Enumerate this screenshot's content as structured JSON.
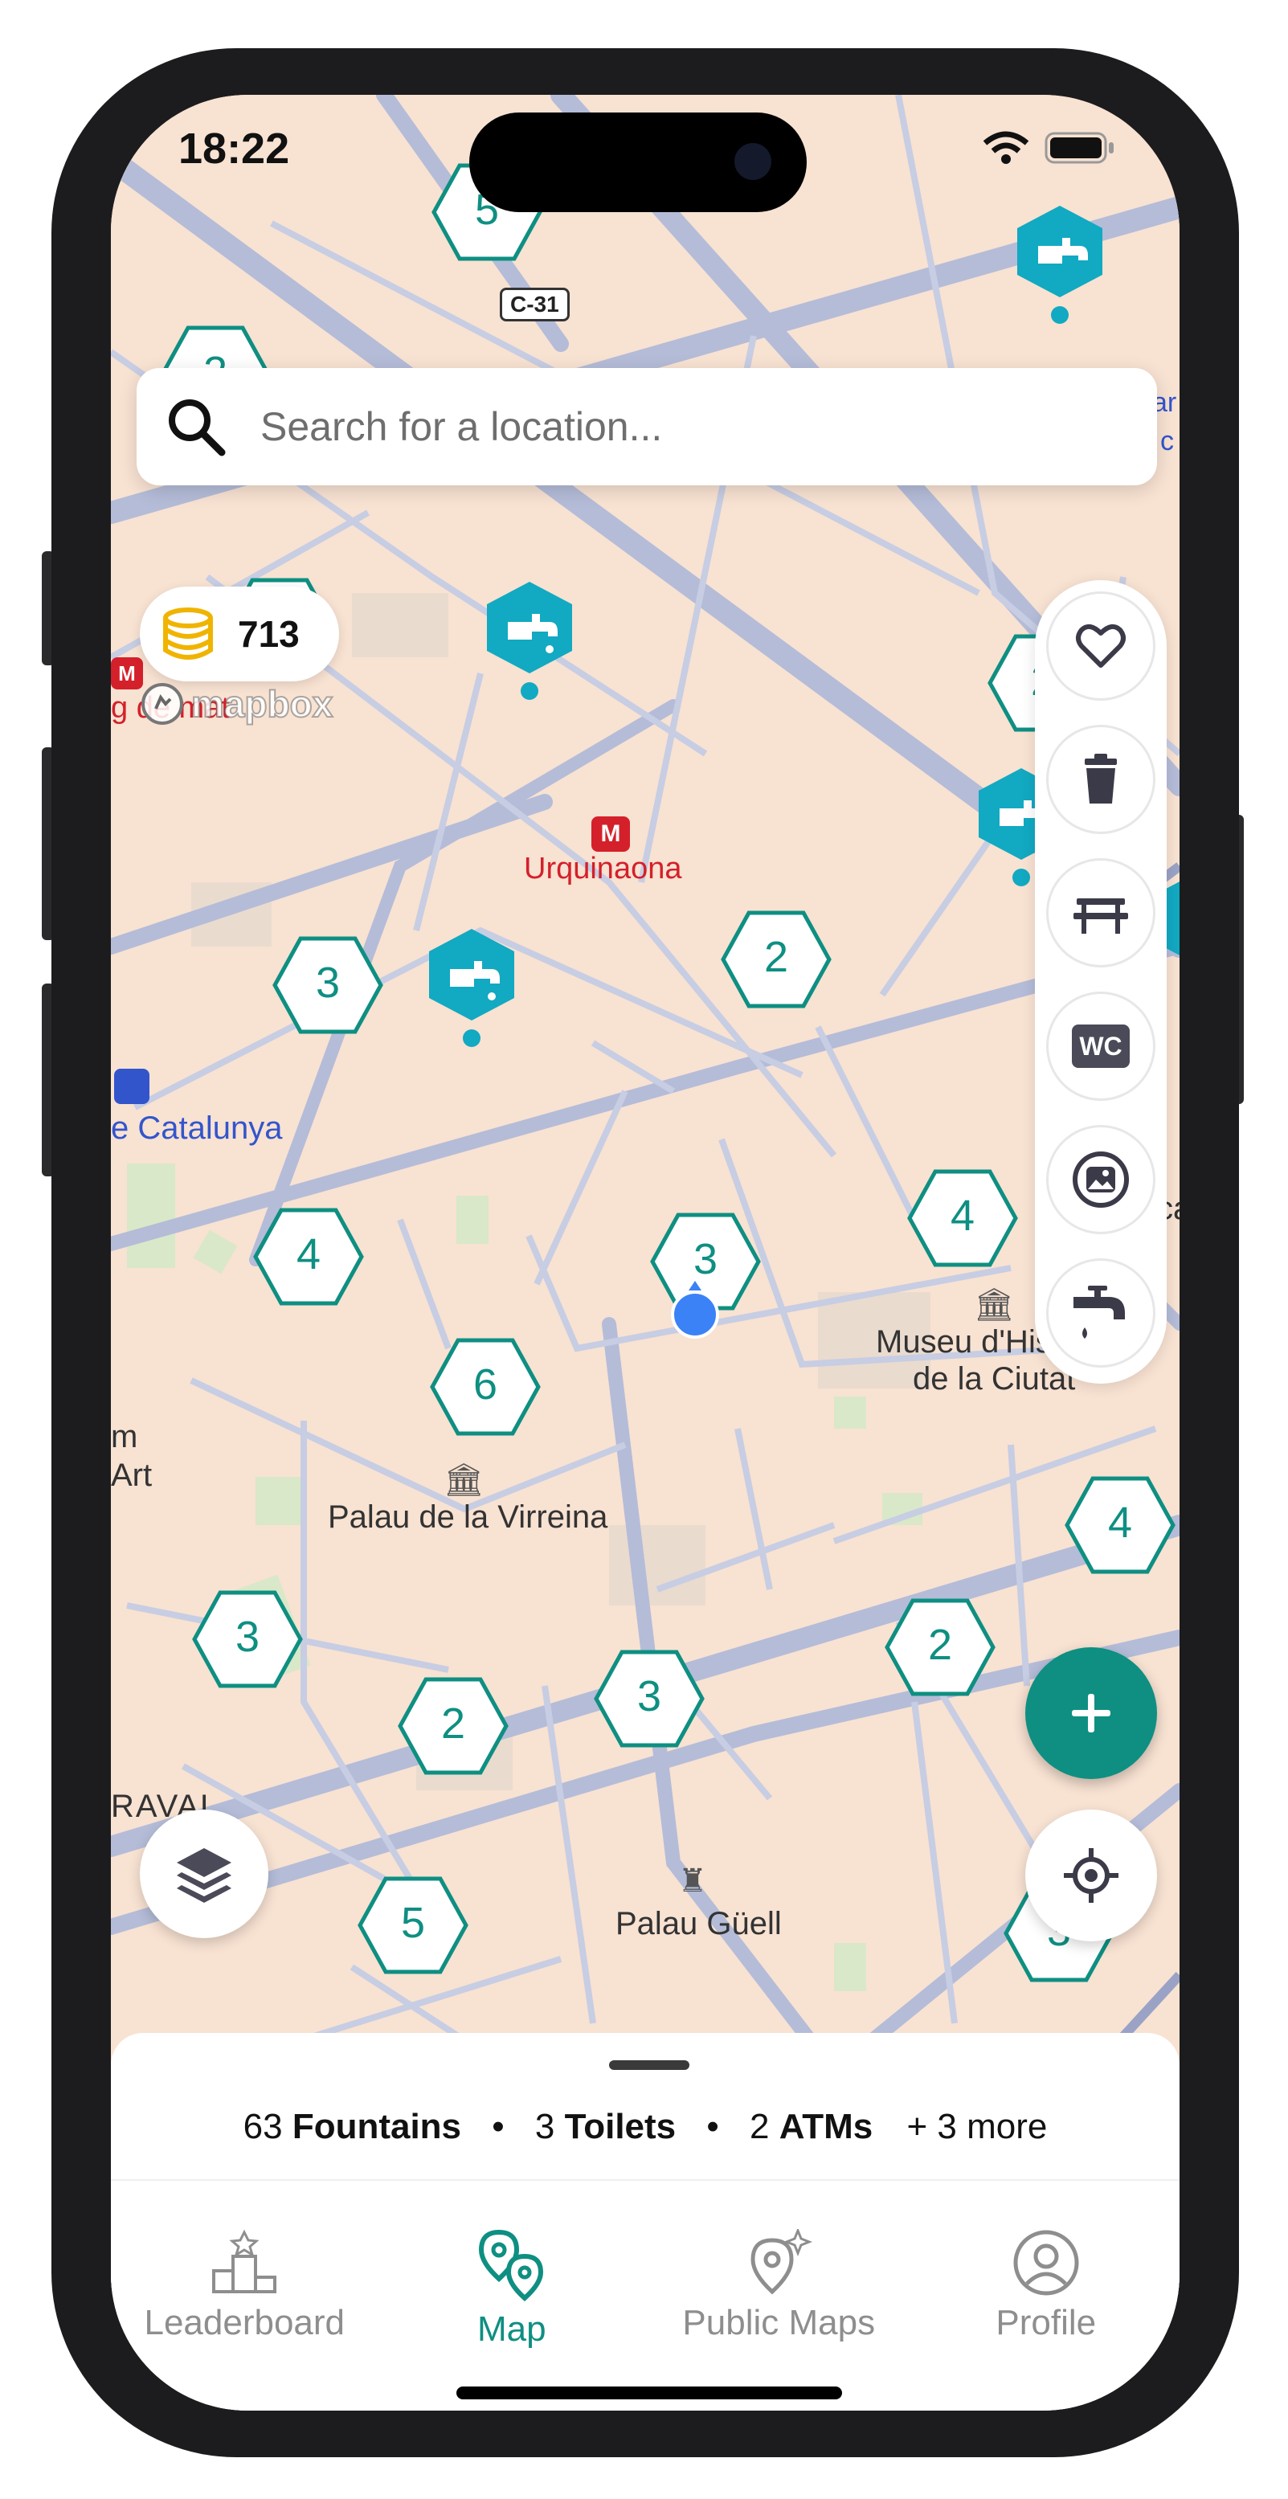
{
  "status_bar": {
    "time": "18:22"
  },
  "search": {
    "placeholder": "Search for a location..."
  },
  "coins": {
    "count": "713"
  },
  "mapbox": {
    "label": "mapbox"
  },
  "map_labels": {
    "urquinaona": "Urquinaona",
    "catalunya": "e Catalunya",
    "museu_line1": "Museu d'Histor",
    "museu_line2": "de la Ciutat",
    "palau_virreina": "Palau de la Virreina",
    "palau_guell": "Palau Güell",
    "raval": "RAVAL",
    "m_label": "m",
    "art_label": "Art",
    "ca_label": "ca",
    "mu_label": "Mu",
    "m_right": "M",
    "road_c31": "C-31",
    "ar_label": "ar",
    "c_label": "c",
    "dorado_label": "g de mat"
  },
  "clusters": [
    {
      "id": "c1",
      "count": "5"
    },
    {
      "id": "c2",
      "count": "2"
    },
    {
      "id": "c3",
      "count": "2"
    },
    {
      "id": "c4",
      "count": "2"
    },
    {
      "id": "c5",
      "count": "3"
    },
    {
      "id": "c6",
      "count": "2"
    },
    {
      "id": "c7",
      "count": "4"
    },
    {
      "id": "c8",
      "count": "4"
    },
    {
      "id": "c9",
      "count": "3"
    },
    {
      "id": "c10",
      "count": "6"
    },
    {
      "id": "c11",
      "count": "4"
    },
    {
      "id": "c12",
      "count": "3"
    },
    {
      "id": "c13",
      "count": "2"
    },
    {
      "id": "c14",
      "count": "3"
    },
    {
      "id": "c15",
      "count": "2"
    },
    {
      "id": "c16",
      "count": "5"
    },
    {
      "id": "c17",
      "count": "3"
    }
  ],
  "summary": {
    "fountains_count": "63",
    "fountains_label": "Fountains",
    "toilets_count": "3",
    "toilets_label": "Toilets",
    "atms_count": "2",
    "atms_label": "ATMs",
    "more": "+ 3 more",
    "separator": "•"
  },
  "tabs": [
    {
      "label": "Leaderboard",
      "icon": "podium-icon",
      "active": false
    },
    {
      "label": "Map",
      "icon": "map-pins-icon",
      "active": true
    },
    {
      "label": "Public Maps",
      "icon": "map-pin-sparkle-icon",
      "active": false
    },
    {
      "label": "Profile",
      "icon": "profile-icon",
      "active": false
    }
  ],
  "toolbar": [
    "heart-icon",
    "trash-icon",
    "bench-icon",
    "wc-icon",
    "photo-icon",
    "faucet-icon"
  ],
  "toolbar_labels": {
    "wc": "WC"
  },
  "colors": {
    "accent": "#0e8f82",
    "fountain": "#12a9c2",
    "user": "#3b82f6",
    "map_bg": "#f8e2d2",
    "road": "#b4bcd8"
  }
}
